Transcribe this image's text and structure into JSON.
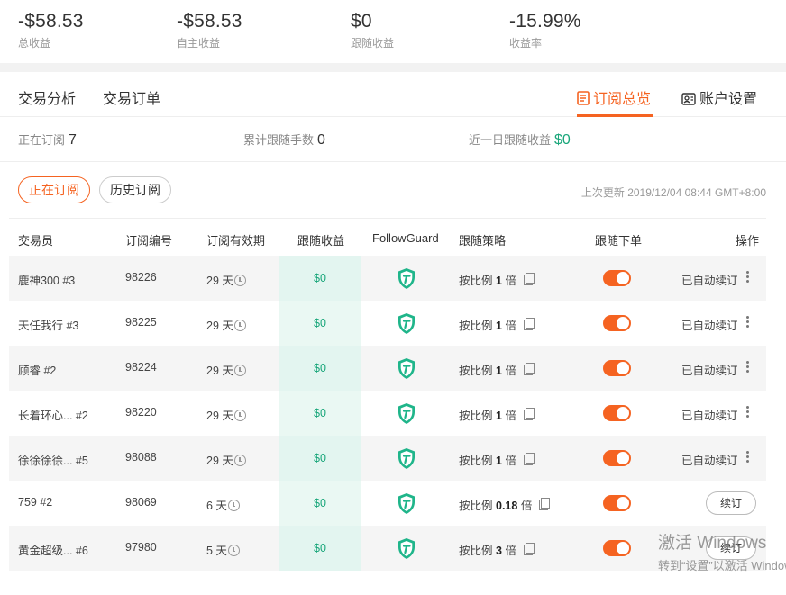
{
  "stats": [
    {
      "value": "-$58.53",
      "label": "总收益"
    },
    {
      "value": "-$58.53",
      "label": "自主收益"
    },
    {
      "value": "$0",
      "label": "跟随收益"
    },
    {
      "value": "-15.99%",
      "label": "收益率"
    }
  ],
  "tabs": {
    "analysis": "交易分析",
    "orders": "交易订单",
    "subscription": "订阅总览",
    "settings": "账户设置"
  },
  "summary": {
    "active_label": "正在订阅",
    "active_value": "7",
    "lots_label": "累计跟随手数",
    "lots_value": "0",
    "recent_label": "近一日跟随收益",
    "recent_value": "$0"
  },
  "filters": {
    "active": "正在订阅",
    "history": "历史订阅",
    "updated": "上次更新 2019/12/04 08:44 GMT+8:00"
  },
  "table": {
    "headers": {
      "trader": "交易员",
      "sub_no": "订阅编号",
      "validity": "订阅有效期",
      "pnl": "跟随收益",
      "guard": "FollowGuard",
      "strategy": "跟随策略",
      "follow": "跟随下单",
      "action": "操作"
    },
    "rows": [
      {
        "trader": "鹿神300 #3",
        "sub_no": "98226",
        "days": "29 天",
        "pnl": "$0",
        "strategy_prefix": "按比例",
        "ratio": "1",
        "strategy_suffix": "倍",
        "follow_on": true,
        "action": "已自动续订",
        "action_type": "text"
      },
      {
        "trader": "天任我行 #3",
        "sub_no": "98225",
        "days": "29 天",
        "pnl": "$0",
        "strategy_prefix": "按比例",
        "ratio": "1",
        "strategy_suffix": "倍",
        "follow_on": true,
        "action": "已自动续订",
        "action_type": "text"
      },
      {
        "trader": "顾睿 #2",
        "sub_no": "98224",
        "days": "29 天",
        "pnl": "$0",
        "strategy_prefix": "按比例",
        "ratio": "1",
        "strategy_suffix": "倍",
        "follow_on": true,
        "action": "已自动续订",
        "action_type": "text"
      },
      {
        "trader": "长着环心... #2",
        "sub_no": "98220",
        "days": "29 天",
        "pnl": "$0",
        "strategy_prefix": "按比例",
        "ratio": "1",
        "strategy_suffix": "倍",
        "follow_on": true,
        "action": "已自动续订",
        "action_type": "text"
      },
      {
        "trader": "徐徐徐徐... #5",
        "sub_no": "98088",
        "days": "29 天",
        "pnl": "$0",
        "strategy_prefix": "按比例",
        "ratio": "1",
        "strategy_suffix": "倍",
        "follow_on": true,
        "action": "已自动续订",
        "action_type": "text"
      },
      {
        "trader": "759 #2",
        "sub_no": "98069",
        "days": "6 天",
        "pnl": "$0",
        "strategy_prefix": "按比例",
        "ratio": "0.18",
        "strategy_suffix": "倍",
        "follow_on": true,
        "action": "续订",
        "action_type": "button"
      },
      {
        "trader": "黄金超级... #6",
        "sub_no": "97980",
        "days": "5 天",
        "pnl": "$0",
        "strategy_prefix": "按比例",
        "ratio": "3",
        "strategy_suffix": "倍",
        "follow_on": true,
        "action": "续订",
        "action_type": "button"
      }
    ]
  },
  "watermark": {
    "line1": "激活 Windows",
    "line2": "转到“设置”以激活 Windows。"
  },
  "colors": {
    "accent": "#f56321",
    "green": "#19a67a",
    "pnl_bg": "#e3f5f0"
  },
  "icons": {
    "subscription_tab": "document-icon",
    "settings_tab": "id-card-icon",
    "guard": "shield-check-icon",
    "validity": "clock-icon",
    "strategy": "copy-icon",
    "more": "kebab-icon"
  }
}
